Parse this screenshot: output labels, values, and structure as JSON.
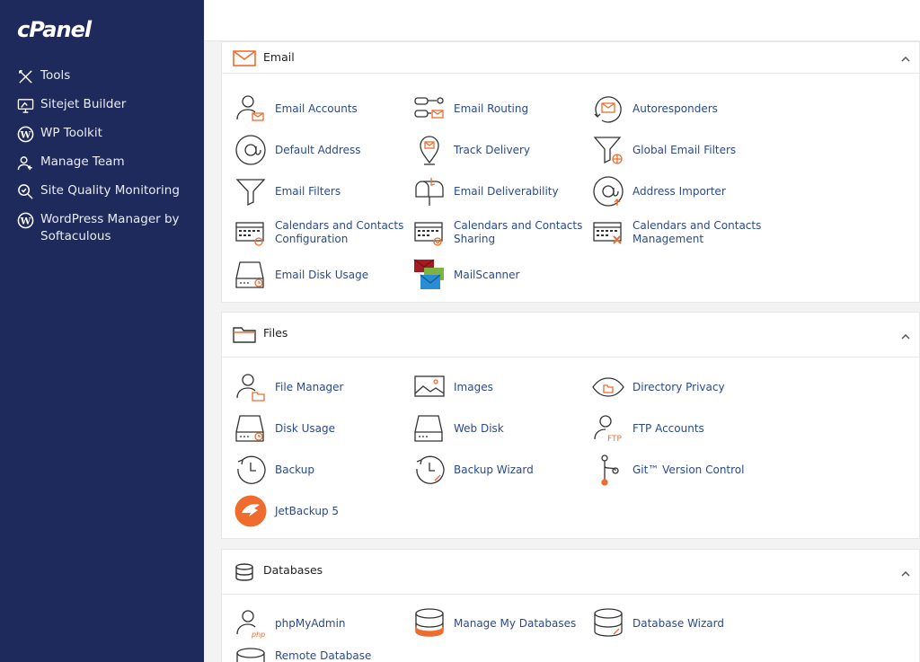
{
  "app": {
    "logo": "cPanel"
  },
  "sidebar": {
    "items": [
      {
        "label": "Tools",
        "icon": "tools-icon"
      },
      {
        "label": "Sitejet Builder",
        "icon": "monitor-icon"
      },
      {
        "label": "WP Toolkit",
        "icon": "wordpress-icon"
      },
      {
        "label": "Manage Team",
        "icon": "user-plus-icon"
      },
      {
        "label": "Site Quality Monitoring",
        "icon": "search-check-icon"
      },
      {
        "label": "WordPress Manager by Softaculous",
        "icon": "wordpress-icon"
      }
    ]
  },
  "sections": {
    "email": {
      "title": "Email",
      "items": [
        {
          "label": "Email Accounts",
          "icon": "user-mail-icon"
        },
        {
          "label": "Email Routing",
          "icon": "routing-icon"
        },
        {
          "label": "Autoresponders",
          "icon": "autoresponder-icon"
        },
        {
          "label": "Default Address",
          "icon": "at-sign-icon"
        },
        {
          "label": "Track Delivery",
          "icon": "location-pin-icon"
        },
        {
          "label": "Global Email Filters",
          "icon": "global-filter-icon"
        },
        {
          "label": "Email Filters",
          "icon": "filter-icon"
        },
        {
          "label": "Email Deliverability",
          "icon": "mailbox-icon"
        },
        {
          "label": "Address Importer",
          "icon": "at-import-icon"
        },
        {
          "label": "Calendars and Contacts Configuration",
          "icon": "calendar-at-icon"
        },
        {
          "label": "Calendars and Contacts Sharing",
          "icon": "calendar-share-icon"
        },
        {
          "label": "Calendars and Contacts Management",
          "icon": "calendar-manage-icon"
        },
        {
          "label": "Email Disk Usage",
          "icon": "disk-usage-icon"
        },
        {
          "label": "MailScanner",
          "icon": "mailscanner-icon"
        }
      ]
    },
    "files": {
      "title": "Files",
      "items": [
        {
          "label": "File Manager",
          "icon": "user-folder-icon"
        },
        {
          "label": "Images",
          "icon": "image-icon"
        },
        {
          "label": "Directory Privacy",
          "icon": "eye-folder-icon"
        },
        {
          "label": "Disk Usage",
          "icon": "disk-icon"
        },
        {
          "label": "Web Disk",
          "icon": "drive-icon"
        },
        {
          "label": "FTP Accounts",
          "icon": "ftp-user-icon"
        },
        {
          "label": "Backup",
          "icon": "backup-clock-icon"
        },
        {
          "label": "Backup Wizard",
          "icon": "backup-wizard-icon"
        },
        {
          "label": "Git™ Version Control",
          "icon": "git-icon"
        },
        {
          "label": "JetBackup 5",
          "icon": "jetbackup-icon"
        }
      ]
    },
    "databases": {
      "title": "Databases",
      "items": [
        {
          "label": "phpMyAdmin",
          "icon": "php-user-icon"
        },
        {
          "label": "Manage My Databases",
          "icon": "database-icon"
        },
        {
          "label": "Database Wizard",
          "icon": "database-wizard-icon"
        },
        {
          "label": "Remote Database Access",
          "icon": "remote-database-icon"
        }
      ]
    }
  },
  "colors": {
    "sidebar": "#1f2a5c",
    "accent": "#ef6c2e",
    "link": "#2a4a8c"
  }
}
